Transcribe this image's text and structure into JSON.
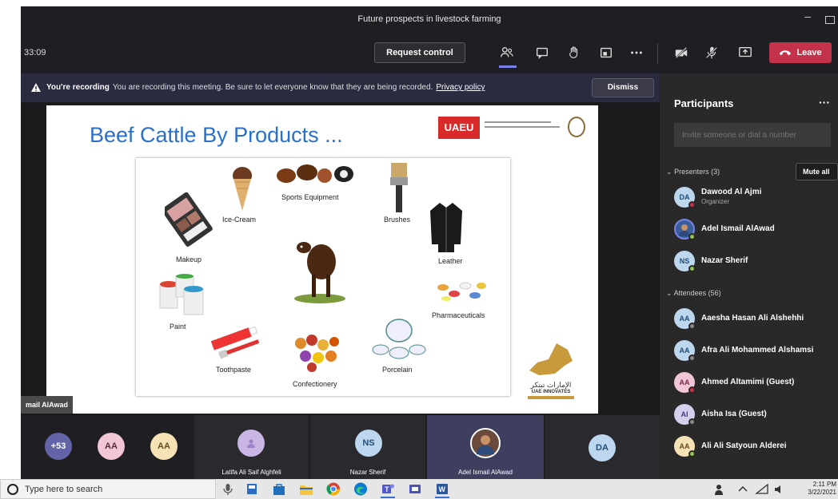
{
  "window": {
    "title": "Future prospects in livestock farming"
  },
  "controls": {
    "timer": "33:09",
    "request_control": "Request control",
    "leave": "Leave"
  },
  "banner": {
    "bold": "You're recording",
    "text": "You are recording this meeting. Be sure to let everyone know that they are being recorded.",
    "link": "Privacy policy",
    "dismiss": "Dismiss"
  },
  "slide": {
    "title": "Beef Cattle By Products ...",
    "logo": "UAEU",
    "labels": {
      "sports": "Sports Equipment",
      "icecream": "Ice-Cream",
      "brushes": "Brushes",
      "makeup": "Makeup",
      "leather": "Leather",
      "pharma": "Pharmaceuticals",
      "paint": "Paint",
      "toothpaste": "Toothpaste",
      "porcelain": "Porcelain",
      "confectionery": "Confectionery"
    },
    "uae_innovates": {
      "arabic": "الإمارات تبتكر",
      "english": "UAE INNOVATES"
    }
  },
  "presenter_tag": "mail AlAwad",
  "gallery": [
    {
      "initials": "+53",
      "name": ""
    },
    {
      "initials": "AA",
      "name": ""
    },
    {
      "initials": "AA",
      "name": ""
    },
    {
      "initials": "",
      "name": "Latifa Ali Saif Alghfeli"
    },
    {
      "initials": "NS",
      "name": "Nazar Sherif"
    },
    {
      "initials": "",
      "name": "Adel Ismail AlAwad"
    },
    {
      "initials": "DA",
      "name": ""
    }
  ],
  "panel": {
    "title": "Participants",
    "invite_placeholder": "Invite someone or dial a number",
    "presenters_header": "Presenters (3)",
    "mute_all": "Mute all",
    "attendees_header": "Attendees (56)",
    "presenters": [
      {
        "initials": "DA",
        "name": "Dawood Al Ajmi",
        "role": "Organizer"
      },
      {
        "initials": "",
        "name": "Adel Ismail AlAwad",
        "role": ""
      },
      {
        "initials": "NS",
        "name": "Nazar Sherif",
        "role": ""
      }
    ],
    "attendees": [
      {
        "initials": "AA",
        "name": "Aaesha Hasan Ali Alshehhi"
      },
      {
        "initials": "AA",
        "name": "Afra Ali Mohammed Alshamsi"
      },
      {
        "initials": "AA",
        "name": "Ahmed Altamimi (Guest)"
      },
      {
        "initials": "AI",
        "name": "Aisha Isa (Guest)"
      },
      {
        "initials": "AA",
        "name": "Ali Ali Satyoun Alderei"
      }
    ]
  },
  "taskbar": {
    "search": "Type here to search",
    "time": "2:11 PM",
    "date": "3/22/2021"
  }
}
